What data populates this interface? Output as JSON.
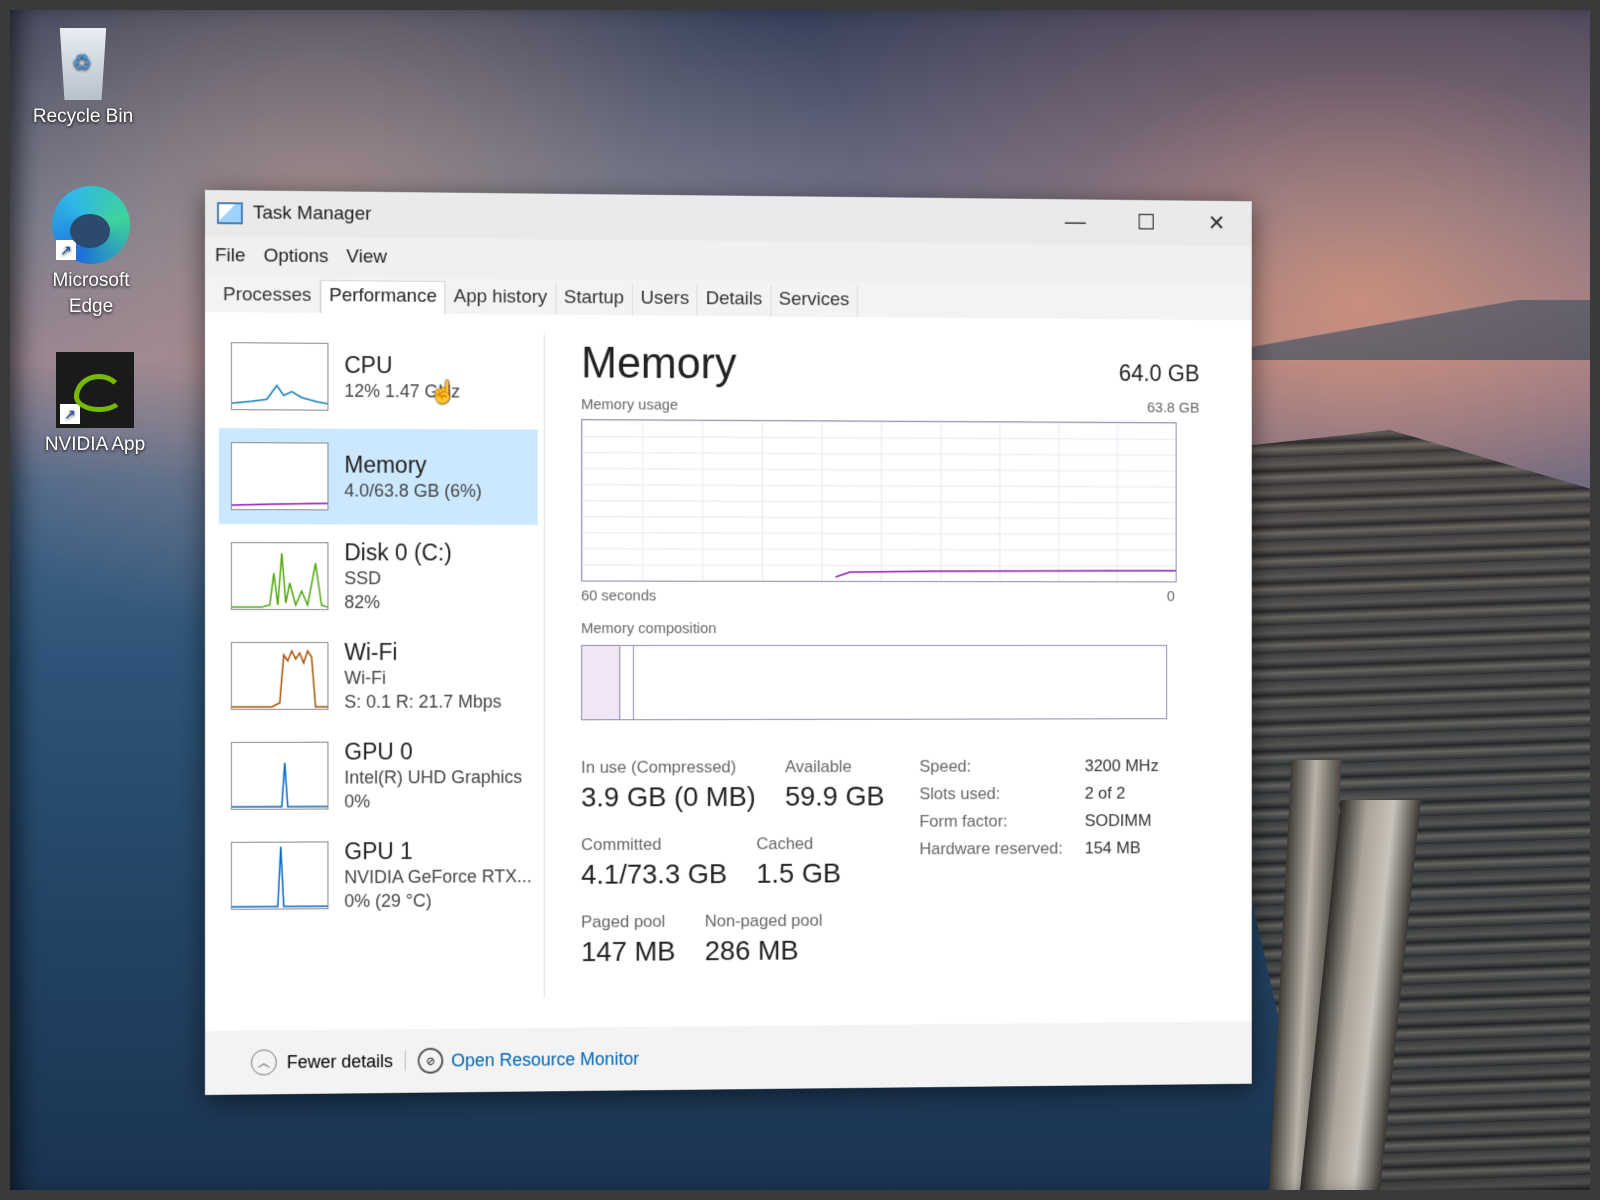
{
  "desktop": {
    "icons": [
      {
        "label": "Recycle Bin"
      },
      {
        "label": "Microsoft Edge"
      },
      {
        "label": "NVIDIA App"
      }
    ]
  },
  "window": {
    "title": "Task Manager",
    "controls": {
      "minimize": "—",
      "maximize": "☐",
      "close": "✕"
    }
  },
  "menu": [
    "File",
    "Options",
    "View"
  ],
  "tabs": [
    "Processes",
    "Performance",
    "App history",
    "Startup",
    "Users",
    "Details",
    "Services"
  ],
  "active_tab": "Performance",
  "sidebar": [
    {
      "title": "CPU",
      "sub1": "12% 1.47 GHz",
      "sub2": "",
      "color": "#117dbb"
    },
    {
      "title": "Memory",
      "sub1": "4.0/63.8 GB (6%)",
      "sub2": "",
      "color": "#8b12ae"
    },
    {
      "title": "Disk 0 (C:)",
      "sub1": "SSD",
      "sub2": "82%",
      "color": "#4da60c"
    },
    {
      "title": "Wi-Fi",
      "sub1": "Wi-Fi",
      "sub2": "S: 0.1 R: 21.7 Mbps",
      "color": "#a74f01"
    },
    {
      "title": "GPU 0",
      "sub1": "Intel(R) UHD Graphics",
      "sub2": "0%",
      "color": "#0068c8"
    },
    {
      "title": "GPU 1",
      "sub1": "NVIDIA GeForce RTX...",
      "sub2": "0% (29 °C)",
      "color": "#0068c8"
    }
  ],
  "memory": {
    "title": "Memory",
    "total": "64.0 GB",
    "usage_label": "Memory usage",
    "usage_max": "63.8 GB",
    "time_left": "60 seconds",
    "time_right": "0",
    "composition_label": "Memory composition",
    "stats": {
      "in_use_label": "In use (Compressed)",
      "in_use_value": "3.9 GB (0 MB)",
      "available_label": "Available",
      "available_value": "59.9 GB",
      "committed_label": "Committed",
      "committed_value": "4.1/73.3 GB",
      "cached_label": "Cached",
      "cached_value": "1.5 GB",
      "paged_label": "Paged pool",
      "paged_value": "147 MB",
      "nonpaged_label": "Non-paged pool",
      "nonpaged_value": "286 MB"
    },
    "specs": [
      {
        "k": "Speed:",
        "v": "3200 MHz"
      },
      {
        "k": "Slots used:",
        "v": "2 of 2"
      },
      {
        "k": "Form factor:",
        "v": "SODIMM"
      },
      {
        "k": "Hardware reserved:",
        "v": "154 MB"
      }
    ]
  },
  "footer": {
    "fewer_details": "Fewer details",
    "resource_monitor": "Open Resource Monitor"
  }
}
